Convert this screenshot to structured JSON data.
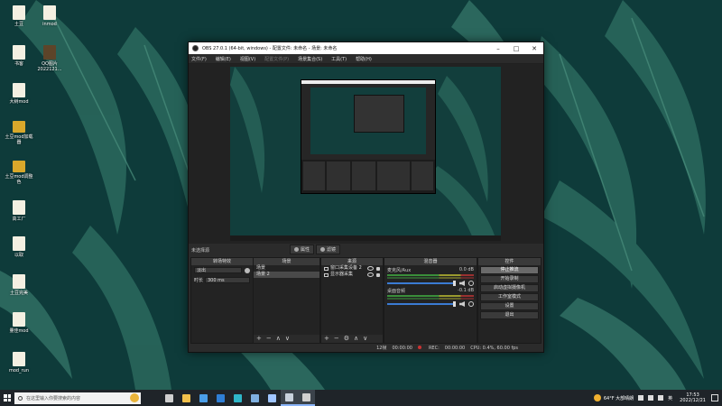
{
  "desktop": {
    "icons": [
      {
        "name": "tudi",
        "label": "土豆",
        "kind": "doc"
      },
      {
        "name": "inmod",
        "label": "inmod",
        "kind": "doc"
      },
      {
        "name": "shuke",
        "label": "书客",
        "kind": "doc"
      },
      {
        "name": "qq-image",
        "label": "QQ图片2022121...",
        "kind": "pack"
      },
      {
        "name": "dashumod",
        "label": "大树mod",
        "kind": "doc"
      },
      {
        "name": "tudimod-loader",
        "label": "土豆mod加载器",
        "kind": "folder"
      },
      {
        "name": "tudimod-tuning",
        "label": "土豆mod调整色",
        "kind": "folder"
      },
      {
        "name": "gaogongchang",
        "label": "高工厂",
        "kind": "doc"
      },
      {
        "name": "yiqu",
        "label": "以取",
        "kind": "doc"
      },
      {
        "name": "tudi-complete",
        "label": "土豆完美",
        "kind": "doc"
      },
      {
        "name": "liangjiamod",
        "label": "量佳mod",
        "kind": "doc"
      },
      {
        "name": "mod-run",
        "label": "mod_run",
        "kind": "doc"
      }
    ]
  },
  "obs": {
    "title": "OBS 27.0.1 (64-bit, windows) - 配置文件: 未命名 - 场景: 未命名",
    "window_buttons": {
      "minimize": "–",
      "maximize": "□",
      "close": "✕"
    },
    "menu": [
      "文件(F)",
      "编辑(E)",
      "视图(V)",
      "配置文件(P)",
      "场景集合(S)",
      "工具(T)",
      "帮助(H)"
    ],
    "menu_disabled": [
      false,
      false,
      false,
      true,
      false,
      false,
      false
    ],
    "no_source_label": "未选择源",
    "properties_button": "属性",
    "filters_button": "滤镜",
    "docks": {
      "transitions": {
        "title": "转场特效",
        "type": "淡出",
        "duration_label": "时长",
        "duration": "300 ms"
      },
      "scenes": {
        "title": "场景",
        "items": [
          "场景",
          "场景 2"
        ],
        "selected": 1
      },
      "sources": {
        "title": "来源",
        "items": [
          "窗口采集设备 2",
          "显示器采集"
        ]
      },
      "mixer": {
        "title": "混音器",
        "channels": [
          {
            "name": "麦克风/Aux",
            "db": "0.0 dB"
          },
          {
            "name": "桌面音频",
            "db": "-0.1 dB"
          }
        ]
      },
      "controls": {
        "title": "控件",
        "buttons": [
          "停止推流",
          "开始录制",
          "启动虚拟摄像机",
          "工作室模式",
          "设置",
          "退出"
        ],
        "active_index": 0
      }
    },
    "dock_footer_icons": {
      "add": "+",
      "remove": "−",
      "up": "∧",
      "down": "∨",
      "settings": "⚙"
    },
    "status": {
      "dropped": "12帧",
      "live_time": "00:00:00",
      "rec_label": "REC:",
      "rec_time": "00:00:00",
      "cpu": "CPU: 0.4%, 60.00 fps"
    }
  },
  "taskbar": {
    "search_placeholder": "在这里输入你要搜索的内容",
    "weather": "64°F 大部晴朗",
    "ime": "英",
    "time": "17:53",
    "date": "2022/12/21",
    "apps": [
      {
        "name": "task-view",
        "color": "#cfcfcf",
        "active": false
      },
      {
        "name": "file-explorer",
        "color": "#f2c04b",
        "active": false
      },
      {
        "name": "microsoft-store",
        "color": "#4a9ee8",
        "active": false
      },
      {
        "name": "mail",
        "color": "#2f7fd6",
        "active": false
      },
      {
        "name": "edge",
        "color": "#2fb6c8",
        "active": false
      },
      {
        "name": "photos",
        "color": "#7fb0e0",
        "active": false
      },
      {
        "name": "pinned-app",
        "color": "#9fc5ff",
        "active": false
      },
      {
        "name": "steam",
        "color": "#c8d1dc",
        "active": true
      },
      {
        "name": "obs",
        "color": "#d0d0d0",
        "active": true
      }
    ]
  }
}
